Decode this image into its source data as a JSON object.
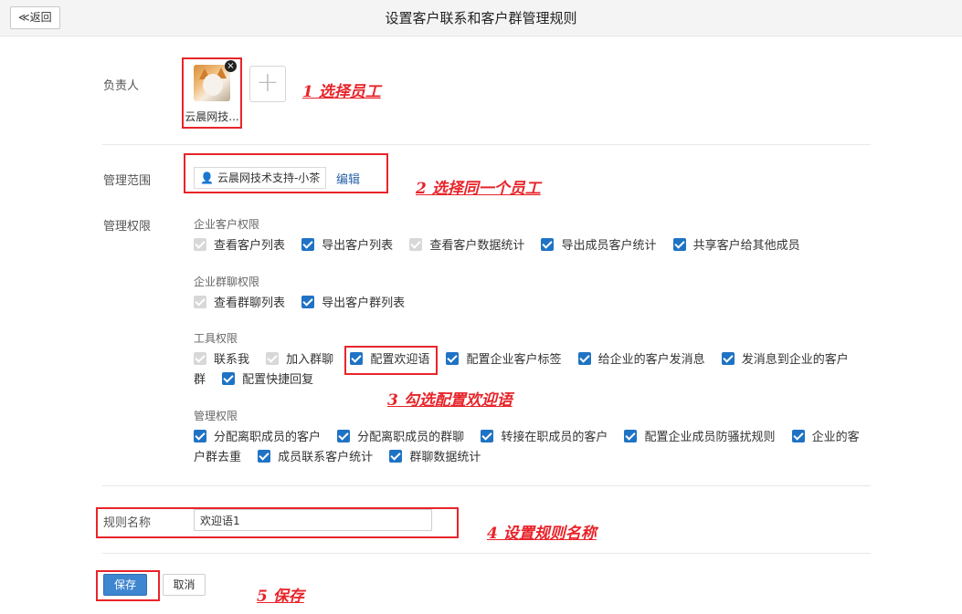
{
  "header": {
    "back_label": "≪返回",
    "title": "设置客户联系和客户群管理规则"
  },
  "owner": {
    "label": "负责人",
    "employee_name": "云晨网技...",
    "remove_glyph": "×",
    "add_glyph": "+"
  },
  "scope": {
    "label": "管理范围",
    "tag_text": "云晨网技术支持-小茶",
    "edit_label": "编辑"
  },
  "permissions": {
    "label": "管理权限",
    "groups": [
      {
        "title": "企业客户权限",
        "items": [
          {
            "label": "查看客户列表",
            "checked": true,
            "disabled": true
          },
          {
            "label": "导出客户列表",
            "checked": true,
            "disabled": false
          },
          {
            "label": "查看客户数据统计",
            "checked": true,
            "disabled": true
          },
          {
            "label": "导出成员客户统计",
            "checked": true,
            "disabled": false
          },
          {
            "label": "共享客户给其他成员",
            "checked": true,
            "disabled": false
          }
        ]
      },
      {
        "title": "企业群聊权限",
        "items": [
          {
            "label": "查看群聊列表",
            "checked": true,
            "disabled": true
          },
          {
            "label": "导出客户群列表",
            "checked": true,
            "disabled": false
          }
        ]
      },
      {
        "title": "工具权限",
        "items": [
          {
            "label": "联系我",
            "checked": true,
            "disabled": true
          },
          {
            "label": "加入群聊",
            "checked": true,
            "disabled": true
          },
          {
            "label": "配置欢迎语",
            "checked": true,
            "disabled": false
          },
          {
            "label": "配置企业客户标签",
            "checked": true,
            "disabled": false
          },
          {
            "label": "给企业的客户发消息",
            "checked": true,
            "disabled": false
          },
          {
            "label": "发消息到企业的客户群",
            "checked": true,
            "disabled": false
          },
          {
            "label": "配置快捷回复",
            "checked": true,
            "disabled": false
          }
        ]
      },
      {
        "title": "管理权限",
        "items": [
          {
            "label": "分配离职成员的客户",
            "checked": true,
            "disabled": false
          },
          {
            "label": "分配离职成员的群聊",
            "checked": true,
            "disabled": false
          },
          {
            "label": "转接在职成员的客户",
            "checked": true,
            "disabled": false
          },
          {
            "label": "配置企业成员防骚扰规则",
            "checked": true,
            "disabled": false
          },
          {
            "label": "企业的客户群去重",
            "checked": true,
            "disabled": false
          },
          {
            "label": "成员联系客户统计",
            "checked": true,
            "disabled": false
          },
          {
            "label": "群聊数据统计",
            "checked": true,
            "disabled": false
          }
        ]
      }
    ]
  },
  "rule_name": {
    "label": "规则名称",
    "value": "欢迎语1"
  },
  "actions": {
    "save_label": "保存",
    "cancel_label": "取消"
  },
  "annotations": {
    "step1": "1 选择员工",
    "step2": "2 选择同一个员工",
    "step3": "3 勾选配置欢迎语",
    "step4": "4 设置规则名称",
    "step5": "5 保存",
    "color": "#e8242a"
  },
  "colors": {
    "checkbox_on": "#1f73c4",
    "checkbox_disabled": "#d8d8d8",
    "save_button": "#3f86d0"
  }
}
